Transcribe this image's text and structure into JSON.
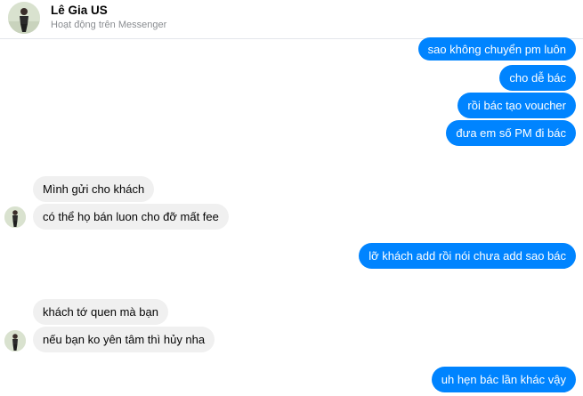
{
  "contact": {
    "name": "Lê Gia US",
    "status": "Hoạt động trên Messenger"
  },
  "messages": [
    {
      "side": "out",
      "text": "sao không chuyển pm luôn"
    },
    {
      "side": "out",
      "text": "cho dễ bác"
    },
    {
      "side": "out",
      "text": "rồi bác tạo voucher"
    },
    {
      "side": "out",
      "text": "đưa em số PM đi bác"
    },
    {
      "side": "in",
      "text": "Mình gửi cho khách"
    },
    {
      "side": "in",
      "text": "có thể họ bán luon cho đỡ mất fee"
    },
    {
      "side": "out",
      "text": "lỡ khách add rồi nói chưa add sao bác"
    },
    {
      "side": "in",
      "text": "khách tớ quen mà bạn"
    },
    {
      "side": "in",
      "text": "nếu bạn ko yên tâm thì hủy nha"
    },
    {
      "side": "out",
      "text": "uh hẹn bác lần khác vậy"
    }
  ],
  "colors": {
    "outgoing_bubble": "#0084ff",
    "incoming_bubble": "#f0f0f0"
  }
}
